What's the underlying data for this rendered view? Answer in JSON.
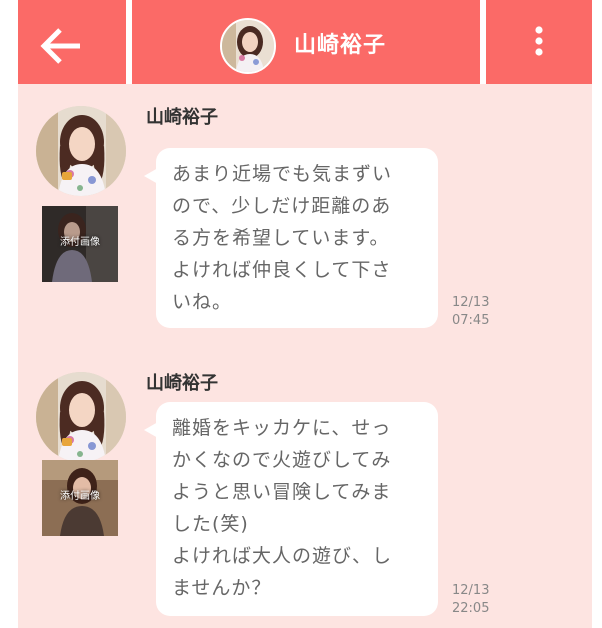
{
  "header": {
    "title": "山崎裕子",
    "back_icon": "back-arrow-icon",
    "menu_icon": "kebab-menu-icon"
  },
  "colors": {
    "header": "#fb6a67",
    "background": "#fde4e1",
    "bubble": "#ffffff",
    "text": "#666666"
  },
  "messages": [
    {
      "sender": "山崎裕子",
      "attachment_label": "添付画像",
      "text": "あまり近場でも気まずい\nので、少しだけ距離のあ\nる方を希望しています。\nよければ仲良くして下さ\nいね。",
      "time": "12/13\n07:45"
    },
    {
      "sender": "山崎裕子",
      "attachment_label": "添付画像",
      "text": "離婚をキッカケに、せっ\nかくなので火遊びしてみ\nようと思い冒険してみま\nした(笑)\nよければ大人の遊び、し\nませんか？",
      "time": "12/13\n22:05"
    }
  ]
}
